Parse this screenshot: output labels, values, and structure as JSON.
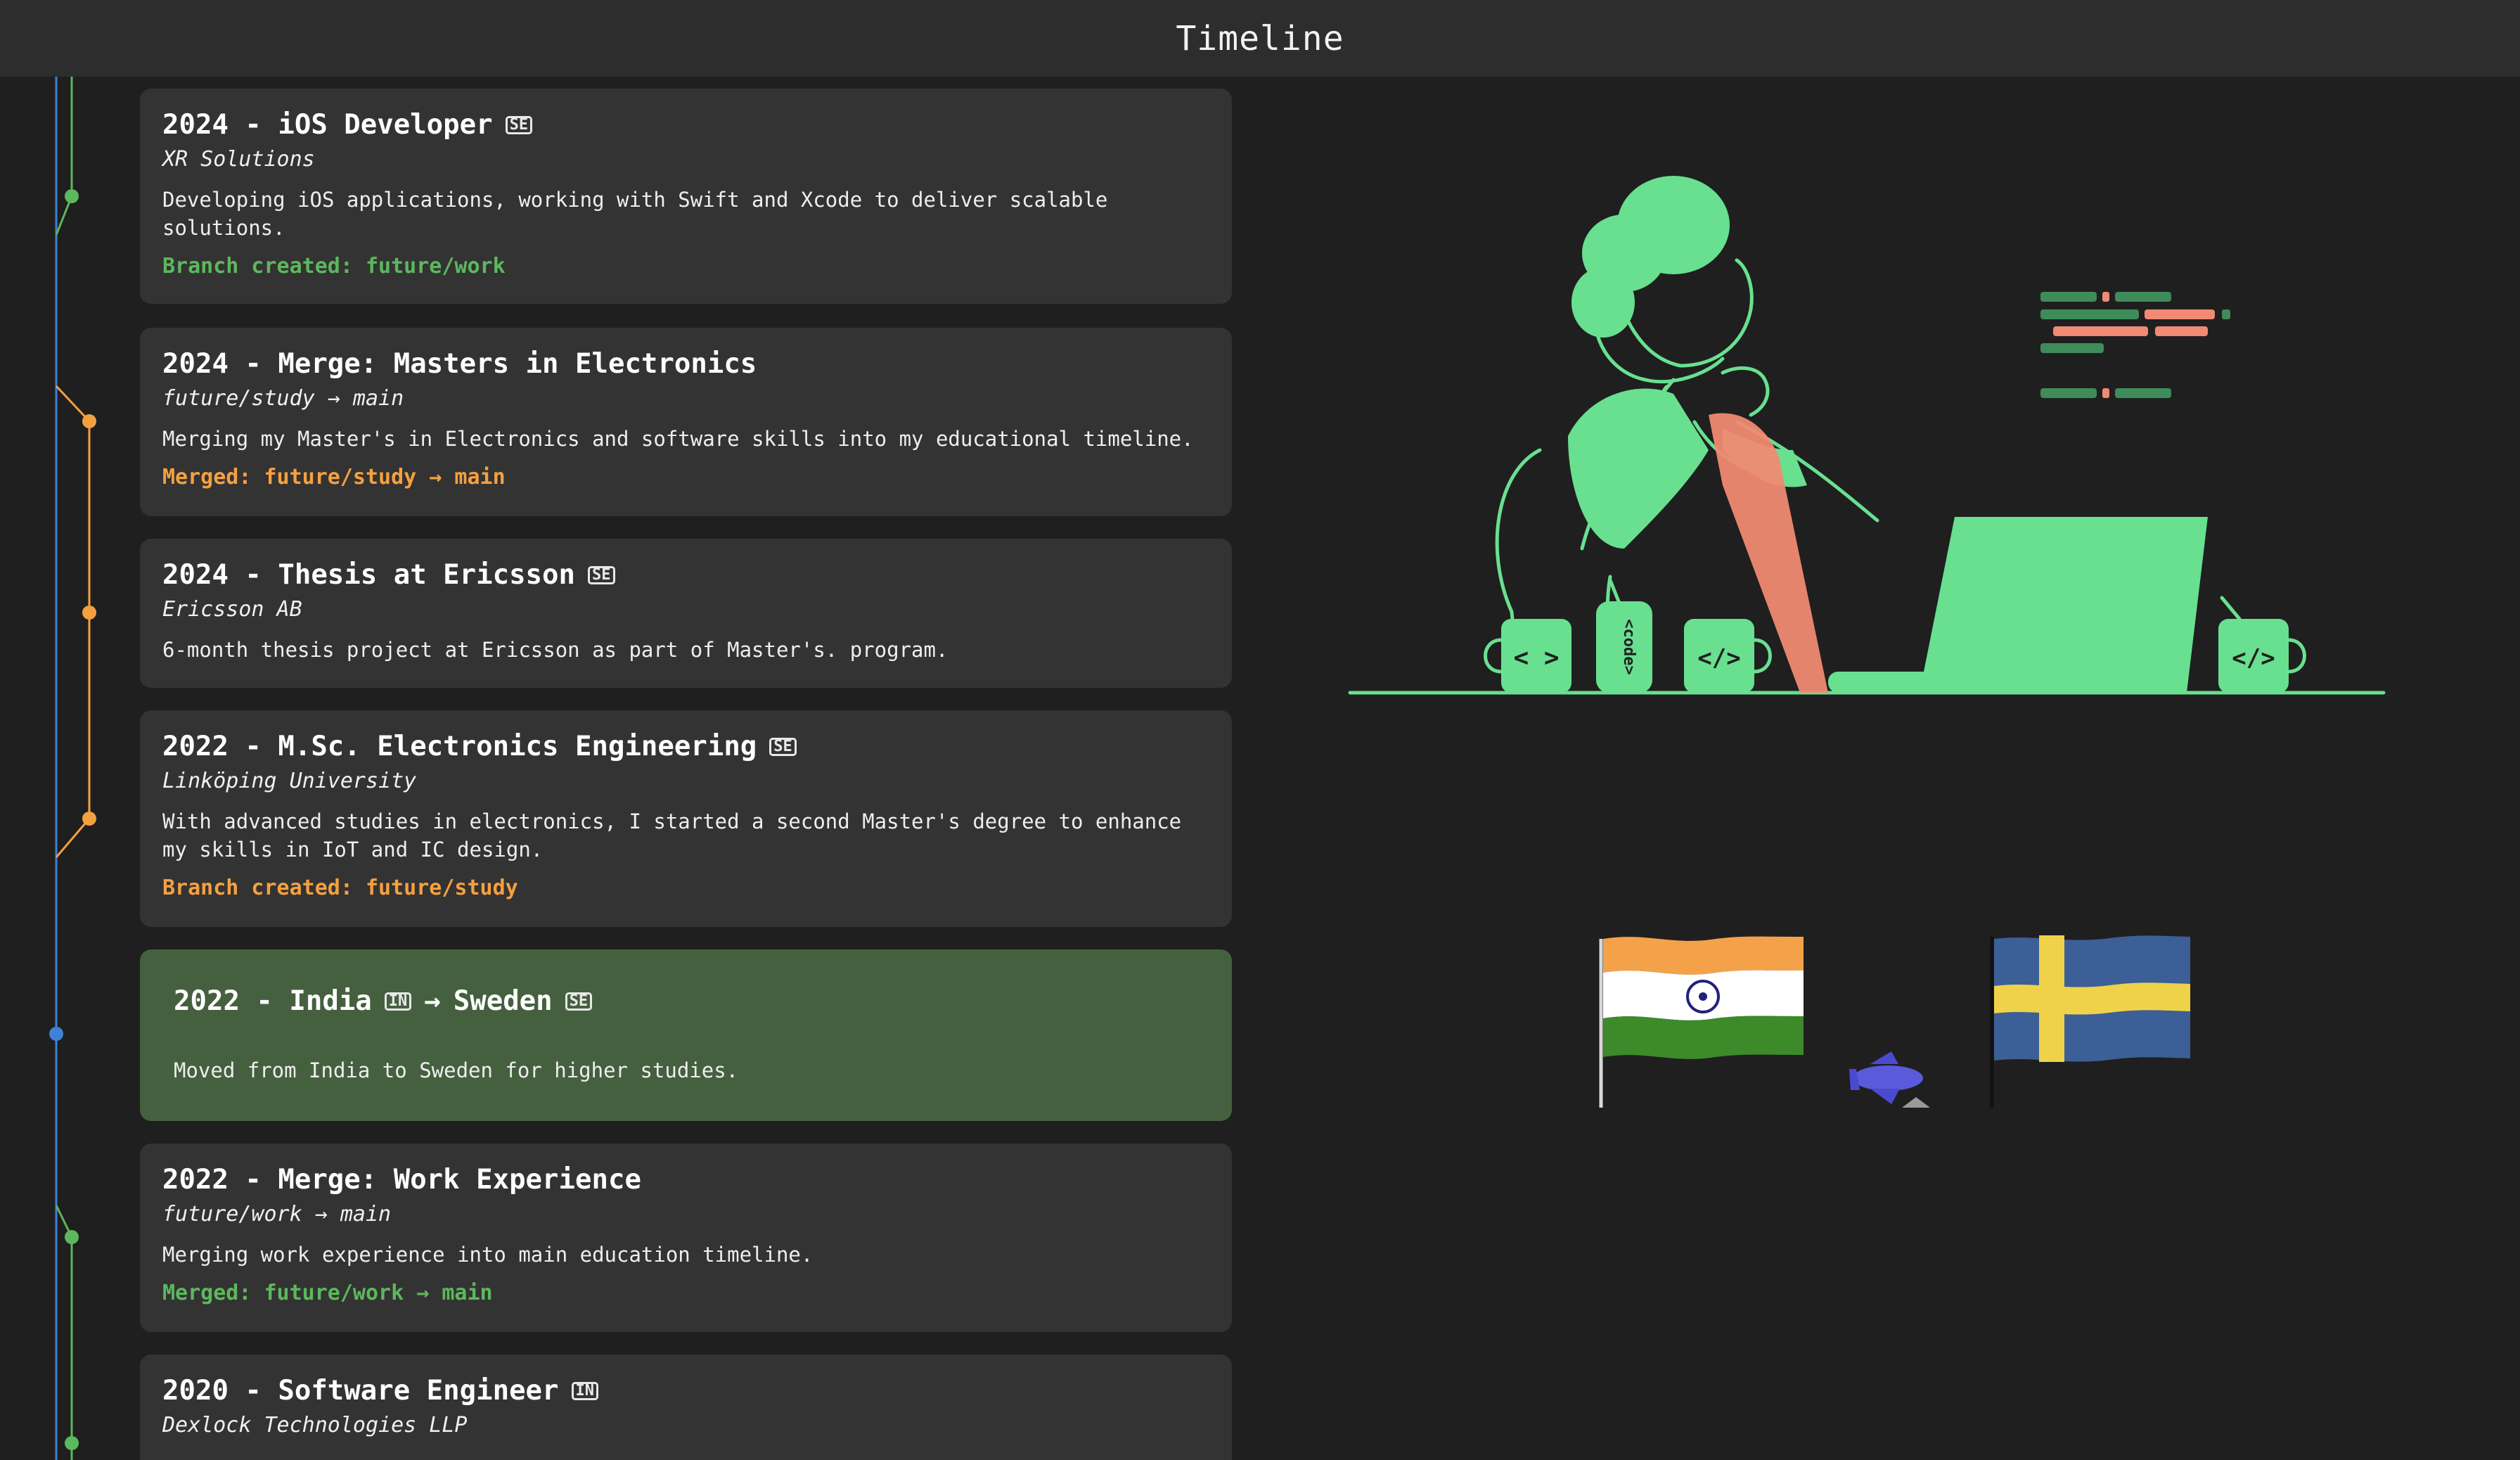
{
  "header": {
    "title": "Timeline"
  },
  "colors": {
    "work": "#5cb85c",
    "study": "#f5a040",
    "main": "#3d82d6",
    "highlight": "#45603f",
    "accent_art": "#68e090",
    "accent_coral": "#f08a72"
  },
  "entries": [
    {
      "title": "2024 - iOS Developer",
      "flag": "SE",
      "org": "XR Solutions",
      "desc": "Developing iOS applications, working with Swift and Xcode to deliver scalable solutions.",
      "branch": "Branch created: future/work",
      "branch_color": "green"
    },
    {
      "title": "2024 - Merge: Masters in Electronics",
      "org": "future/study → main",
      "desc": "Merging my Master's in Electronics and software skills into my educational timeline.",
      "branch": "Merged: future/study → main",
      "branch_color": "orange"
    },
    {
      "title": "2024 - Thesis at Ericsson",
      "flag": "SE",
      "org": "Ericsson AB",
      "desc": "6-month thesis project at Ericsson as part of Master's. program."
    },
    {
      "title": "2022 - M.Sc. Electronics Engineering",
      "flag": "SE",
      "org": "Linköping University",
      "desc": "With advanced studies in electronics, I started a second Master's degree to enhance my skills in IoT and IC design.",
      "branch": "Branch created: future/study",
      "branch_color": "orange"
    },
    {
      "title_from": "2022 - India",
      "flag_from": "IN",
      "arrow": "→",
      "title_to": "Sweden",
      "flag_to": "SE",
      "desc": "Moved from India to Sweden for higher studies."
    },
    {
      "title": "2022 - Merge: Work Experience",
      "org": "future/work → main",
      "desc": "Merging work experience into main education timeline.",
      "branch": "Merged: future/work → main",
      "branch_color": "green"
    },
    {
      "title": "2020 - Software Engineer",
      "flag": "IN",
      "org": "Dexlock Technologies LLP",
      "desc": ""
    }
  ],
  "illustration": {
    "mug_left": "< >",
    "can": "<code>",
    "mug_mid": "</>",
    "mug_right": "</>",
    "flags": {
      "from": "India",
      "to": "Sweden"
    }
  }
}
